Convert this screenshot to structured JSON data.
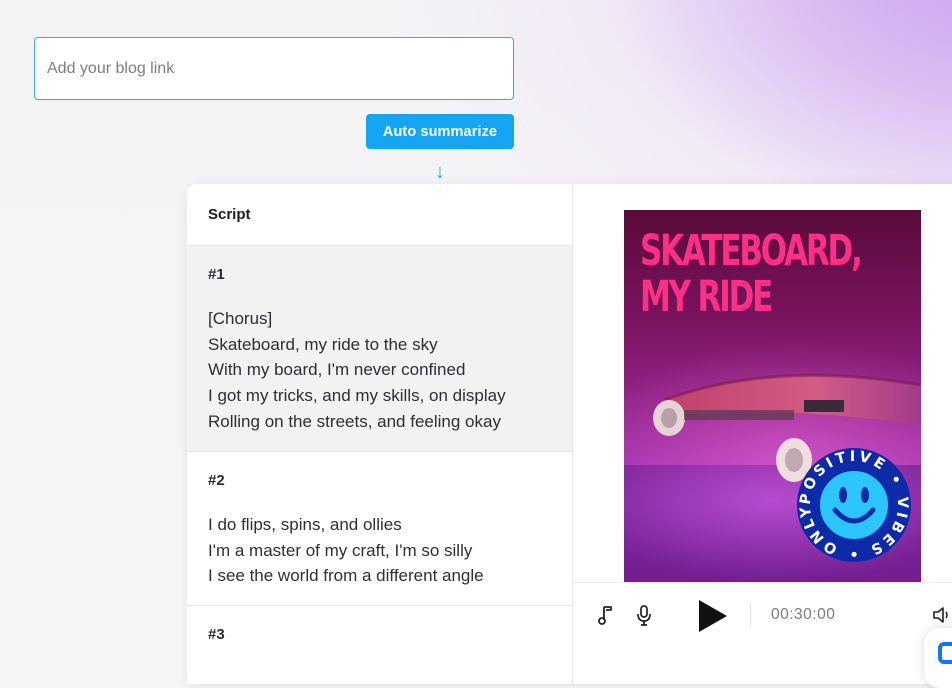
{
  "blog_input": {
    "placeholder": "Add your blog link"
  },
  "auto_summarize": {
    "label": "Auto summarize"
  },
  "arrow": "↓",
  "script_panel": {
    "header": "Script",
    "scenes": [
      {
        "number": "#1",
        "lines": [
          "[Chorus]",
          "Skateboard, my ride to the sky",
          "With my board, I'm never confined",
          "I got my tricks, and my skills, on display",
          "Rolling on the streets, and feeling okay"
        ]
      },
      {
        "number": "#2",
        "lines": [
          "I do flips, spins, and ollies",
          "I'm a master of my craft, I'm so silly",
          "I see the world from a different angle"
        ]
      },
      {
        "number": "#3",
        "lines": []
      }
    ]
  },
  "preview": {
    "poster_title_line1": "SKATEBOARD,",
    "poster_title_line2": "MY RIDE",
    "sticker_text": "POSITIVE • VIBES • ONLY •",
    "colors": {
      "title": "#ff2f86",
      "sticker": "#0d2aa8",
      "sticker_face": "#2cc6ff"
    }
  },
  "player": {
    "time": "00:30:00"
  }
}
